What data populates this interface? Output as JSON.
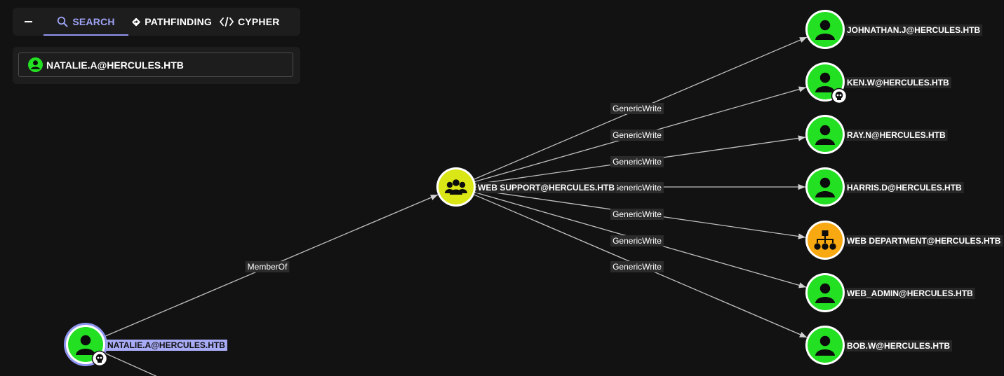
{
  "search": {
    "tabs": [
      {
        "id": "search",
        "label": "SEARCH",
        "icon": "search-icon"
      },
      {
        "id": "pathfinding",
        "label": "PATHFINDING",
        "icon": "pathfinding-icon"
      },
      {
        "id": "cypher",
        "label": "CYPHER",
        "icon": "code-icon"
      }
    ],
    "active_tab": "search",
    "selected_node": "NATALIE.A@HERCULES.HTB"
  },
  "colors": {
    "user_node": "#23e023",
    "group_node": "#dbe617",
    "ou_node": "#f8a810",
    "accent": "#8f95f1",
    "edge": "#bfbfbf",
    "background": "#121212"
  },
  "graph": {
    "nodes": [
      {
        "id": "natalie",
        "label": "NATALIE.A@HERCULES.HTB",
        "type": "user",
        "owned": true,
        "selected": true
      },
      {
        "id": "websupport",
        "label": "WEB SUPPORT@HERCULES.HTB",
        "type": "group",
        "owned": false
      },
      {
        "id": "johnathan",
        "label": "JOHNATHAN.J@HERCULES.HTB",
        "type": "user",
        "owned": false
      },
      {
        "id": "ken",
        "label": "KEN.W@HERCULES.HTB",
        "type": "user",
        "owned": true
      },
      {
        "id": "ray",
        "label": "RAY.N@HERCULES.HTB",
        "type": "user",
        "owned": false
      },
      {
        "id": "harris",
        "label": "HARRIS.D@HERCULES.HTB",
        "type": "user",
        "owned": false
      },
      {
        "id": "webdept",
        "label": "WEB DEPARTMENT@HERCULES.HTB",
        "type": "ou",
        "owned": false
      },
      {
        "id": "webadmin",
        "label": "WEB_ADMIN@HERCULES.HTB",
        "type": "user",
        "owned": false
      },
      {
        "id": "bob",
        "label": "BOB.W@HERCULES.HTB",
        "type": "user",
        "owned": false
      }
    ],
    "edges": [
      {
        "from": "natalie",
        "to": "websupport",
        "label": "MemberOf"
      },
      {
        "from": "websupport",
        "to": "johnathan",
        "label": "GenericWrite"
      },
      {
        "from": "websupport",
        "to": "ken",
        "label": "GenericWrite"
      },
      {
        "from": "websupport",
        "to": "ray",
        "label": "GenericWrite"
      },
      {
        "from": "websupport",
        "to": "harris",
        "label": "GenericWrite"
      },
      {
        "from": "websupport",
        "to": "webdept",
        "label": "GenericWrite"
      },
      {
        "from": "websupport",
        "to": "webadmin",
        "label": "GenericWrite"
      },
      {
        "from": "websupport",
        "to": "bob",
        "label": "GenericWrite"
      }
    ]
  }
}
